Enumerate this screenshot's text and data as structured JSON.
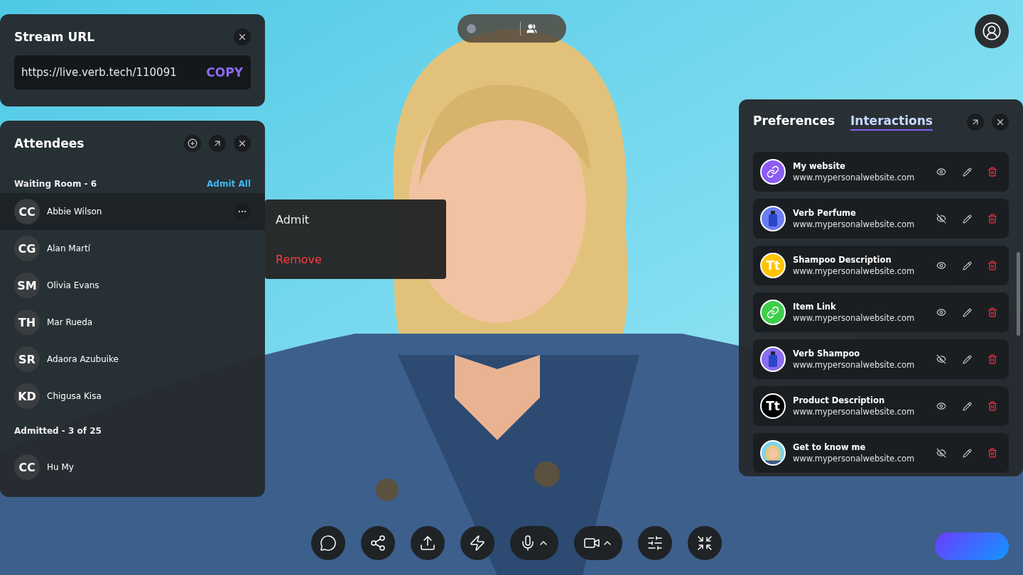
{
  "stream_url": {
    "title": "Stream URL",
    "url": "https://live.verb.tech/110091",
    "copy_label": "COPY"
  },
  "attendees": {
    "title": "Attendees",
    "waiting": {
      "label": "Waiting Room - 6",
      "action": "Admit All",
      "people": [
        {
          "initials": "CC",
          "name": "Abbie Wilson",
          "selected": true
        },
        {
          "initials": "CG",
          "name": "Alan Martí",
          "selected": false
        },
        {
          "initials": "SM",
          "name": "Olivia Evans",
          "selected": false
        },
        {
          "initials": "TH",
          "name": "Mar Rueda",
          "selected": false
        },
        {
          "initials": "SR",
          "name": "Adaora Azubuike",
          "selected": false
        },
        {
          "initials": "KD",
          "name": "Chigusa Kisa",
          "selected": false
        }
      ]
    },
    "admitted": {
      "label": "Admitted - 3 of 25",
      "people": [
        {
          "initials": "CC",
          "name": "Hu My",
          "selected": false
        }
      ]
    }
  },
  "context_menu": [
    {
      "label": "Admit",
      "kind": "normal"
    },
    {
      "label": "Remove",
      "kind": "danger"
    }
  ],
  "side_panel": {
    "tabs": [
      {
        "label": "Preferences",
        "selected": false
      },
      {
        "label": "Interactions",
        "selected": true
      }
    ],
    "items": [
      {
        "kind": "link",
        "color": "#8b5cf6",
        "title": "My website",
        "url": "www.mypersonalwebsite.com",
        "visible": true
      },
      {
        "kind": "product",
        "color": "#6b7cf0",
        "title": "Verb Perfume",
        "url": "www.mypersonalwebsite.com",
        "visible": false
      },
      {
        "kind": "text",
        "color": "#ffc400",
        "glyph": "Tt",
        "title": "Shampoo Description",
        "url": "www.mypersonalwebsite.com",
        "visible": true
      },
      {
        "kind": "link",
        "color": "#3ecf4a",
        "title": "Item Link",
        "url": "www.mypersonalwebsite.com",
        "visible": true
      },
      {
        "kind": "product",
        "color": "#8a6cf0",
        "title": "Verb Shampoo",
        "url": "www.mypersonalwebsite.com",
        "visible": false
      },
      {
        "kind": "text",
        "color": "#000000",
        "glyph": "Tt",
        "title": "Product Description",
        "url": "www.mypersonalwebsite.com",
        "visible": true
      },
      {
        "color": "#7fd3ea",
        "title": "Get to know me",
        "url": "www.mypersonalwebsite.com",
        "visible": false
      }
    ]
  },
  "toolbar": [
    {
      "kind": "chat"
    },
    {
      "kind": "share"
    },
    {
      "kind": "upload"
    },
    {
      "kind": "boost"
    },
    {
      "kind": "mic"
    },
    {
      "kind": "camera"
    },
    {
      "kind": "settings"
    },
    {
      "kind": "shrink"
    }
  ]
}
